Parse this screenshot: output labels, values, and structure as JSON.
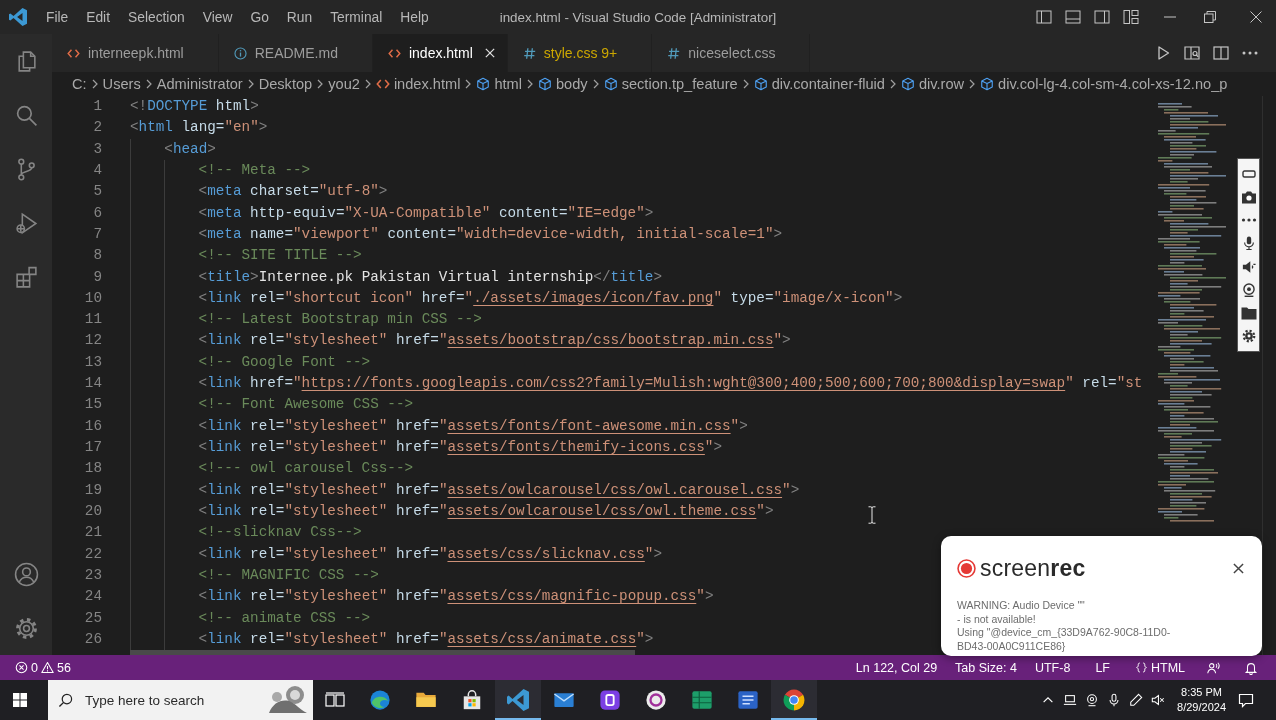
{
  "window": {
    "title": "index.html - Visual Studio Code [Administrator]"
  },
  "menu": [
    "File",
    "Edit",
    "Selection",
    "View",
    "Go",
    "Run",
    "Terminal",
    "Help"
  ],
  "tabs": [
    {
      "label": "interneepk.html",
      "kind": "html",
      "selected": false,
      "warning": false
    },
    {
      "label": "README.md",
      "kind": "markdown",
      "selected": false,
      "warning": false
    },
    {
      "label": "index.html",
      "kind": "html",
      "selected": true,
      "warning": false
    },
    {
      "label": "style.css",
      "badge": "9+",
      "kind": "css",
      "selected": false,
      "warning": true
    },
    {
      "label": "niceselect.css",
      "kind": "css",
      "selected": false,
      "warning": false
    }
  ],
  "breadcrumb": [
    {
      "label": "C:",
      "kind": "folder"
    },
    {
      "label": "Users",
      "kind": "folder"
    },
    {
      "label": "Administrator",
      "kind": "folder"
    },
    {
      "label": "Desktop",
      "kind": "folder"
    },
    {
      "label": "you2",
      "kind": "folder"
    },
    {
      "label": "index.html",
      "kind": "file"
    },
    {
      "label": "html",
      "kind": "element"
    },
    {
      "label": "body",
      "kind": "element"
    },
    {
      "label": "section.tp_feature",
      "kind": "element"
    },
    {
      "label": "div.container-fluid",
      "kind": "element"
    },
    {
      "label": "div.row",
      "kind": "element"
    },
    {
      "label": "div.col-lg-4.col-sm-4.col-xs-12.no_p",
      "kind": "element"
    }
  ],
  "editor": {
    "lines": [
      {
        "number": "1",
        "tokens": [
          {
            "kind": "punct",
            "text": "<!"
          },
          {
            "kind": "tag",
            "text": "DOCTYPE"
          },
          {
            "kind": "attr",
            "text": " html"
          },
          {
            "kind": "punct",
            "text": ">"
          }
        ]
      },
      {
        "number": "2",
        "tokens": [
          {
            "kind": "punct",
            "text": "<"
          },
          {
            "kind": "tag",
            "text": "html"
          },
          {
            "kind": "attr",
            "text": " lang="
          },
          {
            "kind": "string",
            "text": "\"en\""
          },
          {
            "kind": "punct",
            "text": ">"
          }
        ],
        "children": [
          {
            "number": "3",
            "tokens": [
              {
                "kind": "punct",
                "text": "<"
              },
              {
                "kind": "tag",
                "text": "head"
              },
              {
                "kind": "punct",
                "text": ">"
              }
            ],
            "children": [
              {
                "number": "4",
                "tokens": [
                  {
                    "kind": "comment",
                    "text": "<!-- Meta -->"
                  }
                ]
              },
              {
                "number": "5",
                "tokens": [
                  {
                    "kind": "punct",
                    "text": "<"
                  },
                  {
                    "kind": "tag",
                    "text": "meta"
                  },
                  {
                    "kind": "attr",
                    "text": " charset="
                  },
                  {
                    "kind": "string",
                    "text": "\"utf-8\""
                  },
                  {
                    "kind": "punct",
                    "text": ">"
                  }
                ]
              },
              {
                "number": "6",
                "tokens": [
                  {
                    "kind": "punct",
                    "text": "<"
                  },
                  {
                    "kind": "tag",
                    "text": "meta"
                  },
                  {
                    "kind": "attr",
                    "text": " http-equiv="
                  },
                  {
                    "kind": "string",
                    "text": "\"X-UA-Compatible\""
                  },
                  {
                    "kind": "attr",
                    "text": " content="
                  },
                  {
                    "kind": "string",
                    "text": "\"IE=edge\""
                  },
                  {
                    "kind": "punct",
                    "text": ">"
                  }
                ]
              },
              {
                "number": "7",
                "tokens": [
                  {
                    "kind": "punct",
                    "text": "<"
                  },
                  {
                    "kind": "tag",
                    "text": "meta"
                  },
                  {
                    "kind": "attr",
                    "text": " name="
                  },
                  {
                    "kind": "string",
                    "text": "\"viewport\""
                  },
                  {
                    "kind": "attr",
                    "text": " content="
                  },
                  {
                    "kind": "string",
                    "text": "\"width=device-width, initial-scale=1\""
                  },
                  {
                    "kind": "punct",
                    "text": ">"
                  }
                ]
              },
              {
                "number": "8",
                "tokens": [
                  {
                    "kind": "comment",
                    "text": "<!-- SITE TITLE -->"
                  }
                ]
              },
              {
                "number": "9",
                "tokens": [
                  {
                    "kind": "punct",
                    "text": "<"
                  },
                  {
                    "kind": "tag",
                    "text": "title"
                  },
                  {
                    "kind": "punct",
                    "text": ">"
                  },
                  {
                    "kind": "text",
                    "text": "Internee.pk Pakistan Virtual internship"
                  },
                  {
                    "kind": "punct",
                    "text": "</"
                  },
                  {
                    "kind": "tag",
                    "text": "title"
                  },
                  {
                    "kind": "punct",
                    "text": ">"
                  }
                ]
              },
              {
                "number": "10",
                "tokens": [
                  {
                    "kind": "punct",
                    "text": "<"
                  },
                  {
                    "kind": "tag",
                    "text": "link"
                  },
                  {
                    "kind": "attr",
                    "text": " rel="
                  },
                  {
                    "kind": "string",
                    "text": "\"shortcut icon\""
                  },
                  {
                    "kind": "attr",
                    "text": " href="
                  },
                  {
                    "kind": "string",
                    "text": "\""
                  },
                  {
                    "kind": "link",
                    "text": "./assets/images/icon/fav.png"
                  },
                  {
                    "kind": "string",
                    "text": "\""
                  },
                  {
                    "kind": "attr",
                    "text": " type="
                  },
                  {
                    "kind": "string",
                    "text": "\"image/x-icon\""
                  },
                  {
                    "kind": "punct",
                    "text": ">"
                  }
                ]
              },
              {
                "number": "11",
                "tokens": [
                  {
                    "kind": "comment",
                    "text": "<!-- Latest Bootstrap min CSS -->"
                  }
                ]
              },
              {
                "number": "12",
                "tokens": [
                  {
                    "kind": "punct",
                    "text": "<"
                  },
                  {
                    "kind": "tag",
                    "text": "link"
                  },
                  {
                    "kind": "attr",
                    "text": " rel="
                  },
                  {
                    "kind": "string",
                    "text": "\"stylesheet\""
                  },
                  {
                    "kind": "attr",
                    "text": " href="
                  },
                  {
                    "kind": "string",
                    "text": "\""
                  },
                  {
                    "kind": "link",
                    "text": "assets/bootstrap/css/bootstrap.min.css"
                  },
                  {
                    "kind": "string",
                    "text": "\""
                  },
                  {
                    "kind": "punct",
                    "text": ">"
                  }
                ]
              },
              {
                "number": "13",
                "tokens": [
                  {
                    "kind": "comment",
                    "text": "<!-- Google Font -->"
                  }
                ]
              },
              {
                "number": "14",
                "tokens": [
                  {
                    "kind": "punct",
                    "text": "<"
                  },
                  {
                    "kind": "tag",
                    "text": "link"
                  },
                  {
                    "kind": "attr",
                    "text": " href="
                  },
                  {
                    "kind": "string",
                    "text": "\""
                  },
                  {
                    "kind": "link",
                    "text": "https://fonts.googleapis.com/css2?family=Mulish:wght@300;400;500;600;700;800&display=swap"
                  },
                  {
                    "kind": "string",
                    "text": "\""
                  },
                  {
                    "kind": "attr",
                    "text": " rel="
                  },
                  {
                    "kind": "string",
                    "text": "\"st"
                  }
                ]
              },
              {
                "number": "15",
                "tokens": [
                  {
                    "kind": "comment",
                    "text": "<!-- Font Awesome CSS -->"
                  }
                ]
              },
              {
                "number": "16",
                "tokens": [
                  {
                    "kind": "punct",
                    "text": "<"
                  },
                  {
                    "kind": "tag",
                    "text": "link"
                  },
                  {
                    "kind": "attr",
                    "text": " rel="
                  },
                  {
                    "kind": "string",
                    "text": "\"stylesheet\""
                  },
                  {
                    "kind": "attr",
                    "text": " href="
                  },
                  {
                    "kind": "string",
                    "text": "\""
                  },
                  {
                    "kind": "link",
                    "text": "assets/fonts/font-awesome.min.css"
                  },
                  {
                    "kind": "string",
                    "text": "\""
                  },
                  {
                    "kind": "punct",
                    "text": ">"
                  }
                ]
              },
              {
                "number": "17",
                "tokens": [
                  {
                    "kind": "punct",
                    "text": "<"
                  },
                  {
                    "kind": "tag",
                    "text": "link"
                  },
                  {
                    "kind": "attr",
                    "text": " rel="
                  },
                  {
                    "kind": "string",
                    "text": "\"stylesheet\""
                  },
                  {
                    "kind": "attr",
                    "text": " href="
                  },
                  {
                    "kind": "string",
                    "text": "\""
                  },
                  {
                    "kind": "link",
                    "text": "assets/fonts/themify-icons.css"
                  },
                  {
                    "kind": "string",
                    "text": "\""
                  },
                  {
                    "kind": "punct",
                    "text": ">"
                  }
                ]
              },
              {
                "number": "18",
                "tokens": [
                  {
                    "kind": "comment",
                    "text": "<!--- owl carousel Css-->"
                  }
                ]
              },
              {
                "number": "19",
                "tokens": [
                  {
                    "kind": "punct",
                    "text": "<"
                  },
                  {
                    "kind": "tag",
                    "text": "link"
                  },
                  {
                    "kind": "attr",
                    "text": " rel="
                  },
                  {
                    "kind": "string",
                    "text": "\"stylesheet\""
                  },
                  {
                    "kind": "attr",
                    "text": " href="
                  },
                  {
                    "kind": "string",
                    "text": "\""
                  },
                  {
                    "kind": "link",
                    "text": "assets/owlcarousel/css/owl.carousel.css"
                  },
                  {
                    "kind": "string",
                    "text": "\""
                  },
                  {
                    "kind": "punct",
                    "text": ">"
                  }
                ]
              },
              {
                "number": "20",
                "tokens": [
                  {
                    "kind": "punct",
                    "text": "<"
                  },
                  {
                    "kind": "tag",
                    "text": "link"
                  },
                  {
                    "kind": "attr",
                    "text": " rel="
                  },
                  {
                    "kind": "string",
                    "text": "\"stylesheet\""
                  },
                  {
                    "kind": "attr",
                    "text": " href="
                  },
                  {
                    "kind": "string",
                    "text": "\""
                  },
                  {
                    "kind": "link",
                    "text": "assets/owlcarousel/css/owl.theme.css"
                  },
                  {
                    "kind": "string",
                    "text": "\""
                  },
                  {
                    "kind": "punct",
                    "text": ">"
                  }
                ]
              },
              {
                "number": "21",
                "tokens": [
                  {
                    "kind": "comment",
                    "text": "<!--slicknav Css-->"
                  }
                ]
              },
              {
                "number": "22",
                "tokens": [
                  {
                    "kind": "punct",
                    "text": "<"
                  },
                  {
                    "kind": "tag",
                    "text": "link"
                  },
                  {
                    "kind": "attr",
                    "text": " rel="
                  },
                  {
                    "kind": "string",
                    "text": "\"stylesheet\""
                  },
                  {
                    "kind": "attr",
                    "text": " href="
                  },
                  {
                    "kind": "string",
                    "text": "\""
                  },
                  {
                    "kind": "link",
                    "text": "assets/css/slicknav.css"
                  },
                  {
                    "kind": "string",
                    "text": "\""
                  },
                  {
                    "kind": "punct",
                    "text": ">"
                  }
                ]
              },
              {
                "number": "23",
                "tokens": [
                  {
                    "kind": "comment",
                    "text": "<!-- MAGNIFIC CSS -->"
                  }
                ]
              },
              {
                "number": "24",
                "tokens": [
                  {
                    "kind": "punct",
                    "text": "<"
                  },
                  {
                    "kind": "tag",
                    "text": "link"
                  },
                  {
                    "kind": "attr",
                    "text": " rel="
                  },
                  {
                    "kind": "string",
                    "text": "\"stylesheet\""
                  },
                  {
                    "kind": "attr",
                    "text": " href="
                  },
                  {
                    "kind": "string",
                    "text": "\""
                  },
                  {
                    "kind": "link",
                    "text": "assets/css/magnific-popup.css"
                  },
                  {
                    "kind": "string",
                    "text": "\""
                  },
                  {
                    "kind": "punct",
                    "text": ">"
                  }
                ]
              },
              {
                "number": "25",
                "tokens": [
                  {
                    "kind": "comment",
                    "text": "<!-- animate CSS -->"
                  }
                ]
              },
              {
                "number": "26",
                "tokens": [
                  {
                    "kind": "punct",
                    "text": "<"
                  },
                  {
                    "kind": "tag",
                    "text": "link"
                  },
                  {
                    "kind": "attr",
                    "text": " rel="
                  },
                  {
                    "kind": "string",
                    "text": "\"stylesheet\""
                  },
                  {
                    "kind": "attr",
                    "text": " href="
                  },
                  {
                    "kind": "string",
                    "text": "\""
                  },
                  {
                    "kind": "link",
                    "text": "assets/css/animate.css"
                  },
                  {
                    "kind": "string",
                    "text": "\""
                  },
                  {
                    "kind": "punct",
                    "text": ">"
                  }
                ]
              }
            ]
          }
        ]
      }
    ]
  },
  "status_bar": {
    "errors": "0",
    "warnings": "56",
    "position": "Ln 122, Col 29",
    "indentation": "Tab Size: 4",
    "encoding": "UTF-8",
    "line_ending": "LF",
    "language": "HTML"
  },
  "taskbar": {
    "search": {
      "placeholder": "Type here to search"
    },
    "apps": [
      {
        "kind": "edge",
        "active": false
      },
      {
        "kind": "explorer",
        "active": false
      },
      {
        "kind": "store",
        "active": false
      },
      {
        "kind": "vscode",
        "active": true
      },
      {
        "kind": "mail",
        "active": false
      },
      {
        "kind": "bootstrap",
        "active": false
      },
      {
        "kind": "obs",
        "active": false
      },
      {
        "kind": "spreadsheet",
        "active": false
      },
      {
        "kind": "word",
        "active": false
      },
      {
        "kind": "chrome",
        "active": true
      }
    ],
    "time": "8:35 PM",
    "date": "8/29/2024"
  },
  "notification": {
    "brand": "screen**rec**",
    "message": [
      "WARNING: Audio Device \"\"",
      "- is not available!",
      "Using \"@device_cm_{33D9A762-90C8-11D0-",
      "BD43-00A0C911CE86}"
    ]
  }
}
